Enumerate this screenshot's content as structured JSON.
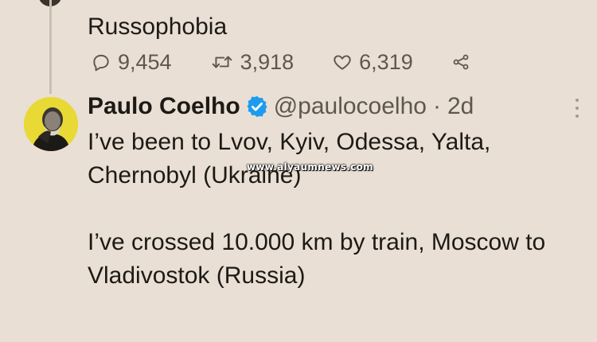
{
  "previous_tweet": {
    "text": "Russophobia",
    "replies": "9,454",
    "retweets": "3,918",
    "likes": "6,319"
  },
  "tweet": {
    "name": "Paulo Coelho",
    "handle": "@paulocoelho",
    "separator": "·",
    "time": "2d",
    "paragraphs": [
      "I’ve been to Lvov, Kyiv, Odessa, Yalta, Chernobyl (Ukraine)",
      "I’ve crossed 10.000 km by train, Moscow to Vladivostok (Russia)"
    ]
  },
  "watermark": "www.alyaumnews.com",
  "icons": {
    "reply": "reply-icon",
    "retweet": "retweet-icon",
    "like": "heart-icon",
    "share": "share-icon",
    "verified": "verified-badge-icon",
    "more": "more-options-icon"
  },
  "colors": {
    "background": "#e9dfd4",
    "text": "#1d1a16",
    "muted": "#5f574e",
    "verified": "#1d9bf0",
    "avatar_bg": "#e8d935"
  }
}
